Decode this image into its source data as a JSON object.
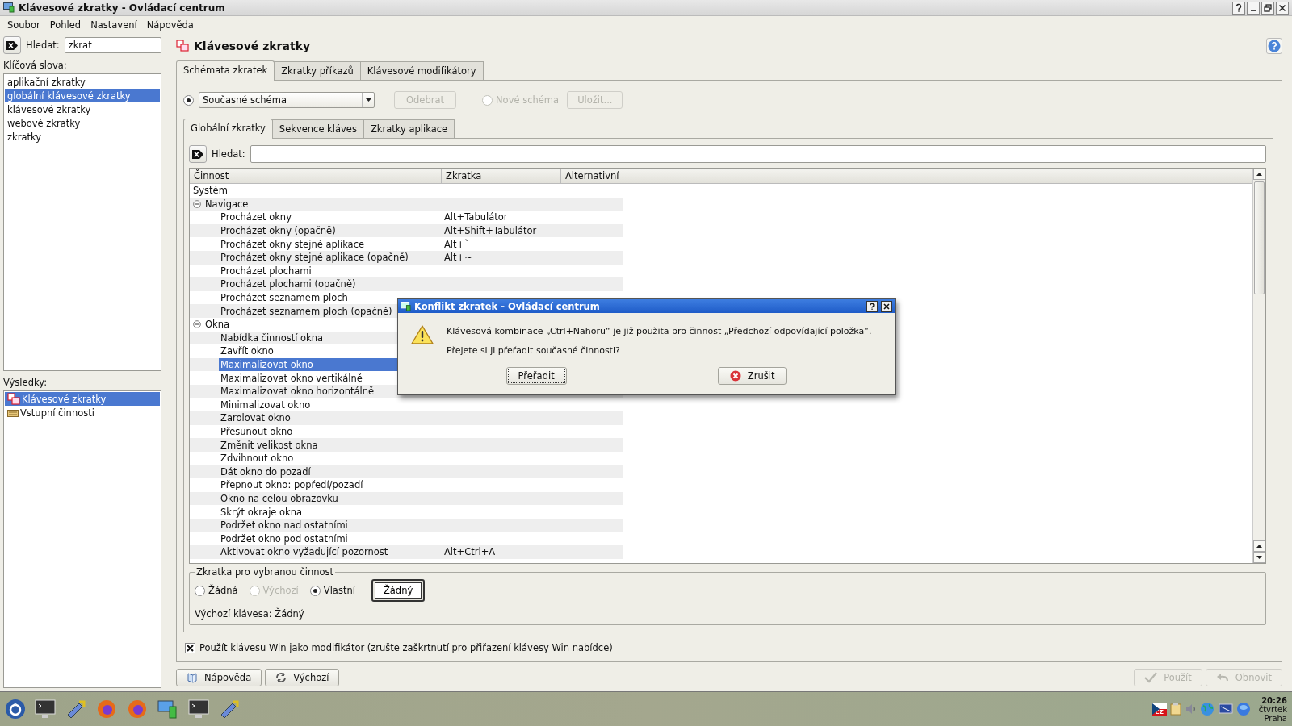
{
  "window": {
    "title": "Klávesové zkratky - Ovládací centrum"
  },
  "menu": [
    "Soubor",
    "Pohled",
    "Nastavení",
    "Nápověda"
  ],
  "sidebar": {
    "search_label": "Hledat:",
    "search_value": "zkrat",
    "keywords_label": "Klíčová slova:",
    "keywords": [
      {
        "label": "aplikační zkratky",
        "selected": false
      },
      {
        "label": "globální klávesové zkratky",
        "selected": true
      },
      {
        "label": "klávesové zkratky",
        "selected": false
      },
      {
        "label": "webové zkratky",
        "selected": false
      },
      {
        "label": "zkratky",
        "selected": false
      }
    ],
    "results_label": "Výsledky:",
    "results": [
      {
        "label": "Klávesové zkratky",
        "kind": "keys",
        "selected": true
      },
      {
        "label": "Vstupní činnosti",
        "kind": "input",
        "selected": false
      }
    ]
  },
  "module": {
    "title": "Klávesové zkratky",
    "tabs": [
      {
        "label": "Schémata zkratek",
        "selected": true
      },
      {
        "label": "Zkratky příkazů",
        "selected": false
      },
      {
        "label": "Klávesové modifikátory",
        "selected": false
      }
    ],
    "scheme": {
      "current_selected": true,
      "current_value": "Současné schéma",
      "remove_button": {
        "label": "Odebrat",
        "disabled": true
      },
      "new_scheme": {
        "label": "Nové schéma",
        "selected": false,
        "disabled": true
      },
      "save_button": {
        "label": "Uložit...",
        "disabled": true
      }
    },
    "subtabs": [
      {
        "label": "Globální zkratky",
        "selected": true
      },
      {
        "label": "Sekvence kláves",
        "selected": false
      },
      {
        "label": "Zkratky aplikace",
        "selected": false
      }
    ],
    "search_label": "Hledat:",
    "columns": [
      "Činnost",
      "Zkratka",
      "Alternativní"
    ],
    "tree": [
      {
        "label": "Systém",
        "selected": false,
        "children": [
          {
            "label": "Navigace",
            "expanded": true,
            "selected": false,
            "children": [
              {
                "label": "Procházet okny",
                "shortcut": "Alt+Tabulátor",
                "selected": false
              },
              {
                "label": "Procházet okny (opačně)",
                "shortcut": "Alt+Shift+Tabulátor",
                "selected": false
              },
              {
                "label": "Procházet okny stejné aplikace",
                "shortcut": "Alt+`",
                "selected": false
              },
              {
                "label": "Procházet okny stejné aplikace (opačně)",
                "shortcut": "Alt+~",
                "selected": false
              },
              {
                "label": "Procházet plochami",
                "selected": false
              },
              {
                "label": "Procházet plochami (opačně)",
                "selected": false
              },
              {
                "label": "Procházet seznamem ploch",
                "selected": false
              },
              {
                "label": "Procházet seznamem ploch (opačně)",
                "selected": false
              }
            ]
          },
          {
            "label": "Okna",
            "expanded": true,
            "selected": false,
            "children": [
              {
                "label": "Nabídka činností okna",
                "selected": false
              },
              {
                "label": "Zavřít okno",
                "selected": false
              },
              {
                "label": "Maximalizovat okno",
                "selected": true
              },
              {
                "label": "Maximalizovat okno vertikálně",
                "selected": false
              },
              {
                "label": "Maximalizovat okno horizontálně",
                "selected": false
              },
              {
                "label": "Minimalizovat okno",
                "selected": false
              },
              {
                "label": "Zarolovat okno",
                "selected": false
              },
              {
                "label": "Přesunout okno",
                "selected": false
              },
              {
                "label": "Změnit velikost okna",
                "selected": false
              },
              {
                "label": "Zdvihnout okno",
                "selected": false
              },
              {
                "label": "Dát okno do pozadí",
                "selected": false
              },
              {
                "label": "Přepnout okno: popředí/pozadí",
                "selected": false
              },
              {
                "label": "Okno na celou obrazovku",
                "selected": false
              },
              {
                "label": "Skrýt okraje okna",
                "selected": false
              },
              {
                "label": "Podržet okno nad ostatními",
                "selected": false
              },
              {
                "label": "Podržet okno pod ostatními",
                "selected": false
              },
              {
                "label": "Aktivovat okno vyžadující pozornost",
                "shortcut": "Alt+Ctrl+A",
                "selected": false
              }
            ]
          }
        ]
      }
    ],
    "shortcut_group": {
      "title": "Zkratka pro vybranou činnost",
      "options": [
        {
          "label": "Žádná",
          "selected": false,
          "disabled": false
        },
        {
          "label": "Výchozí",
          "selected": false,
          "disabled": true
        },
        {
          "label": "Vlastní",
          "selected": true,
          "disabled": false
        }
      ],
      "key_button": "Žádný",
      "default_key": "Výchozí klávesa: Žádný"
    },
    "win_modifier": {
      "label": "Použít klávesu Win jako modifikátor (zrušte zaškrtnutí pro přiřazení klávesy Win nabídce)",
      "checked": true
    }
  },
  "buttons": [
    {
      "label": "Nápověda",
      "kind": "help",
      "disabled": false
    },
    {
      "label": "Výchozí",
      "kind": "defaults",
      "disabled": false
    },
    {
      "label": "Použít",
      "kind": "apply",
      "disabled": true
    },
    {
      "label": "Obnovit",
      "kind": "reset",
      "disabled": true
    }
  ],
  "dialog": {
    "title": "Konflikt zkratek - Ovládací centrum",
    "message": "Klávesová kombinace „Ctrl+Nahoru“ je již použita pro činnost „Předchozí odpovídající položka“.",
    "question": "Přejete si ji přeřadit současné činnosti?",
    "buttons": [
      {
        "label": "Přeřadit",
        "kind": "confirm",
        "focused": true
      },
      {
        "label": "Zrušit",
        "kind": "cancel",
        "focused": false
      }
    ]
  },
  "taskbar": {
    "keyboard_layout": "CZ",
    "clock": {
      "time": "20:26",
      "day": "čtvrtek",
      "place": "Praha"
    }
  }
}
